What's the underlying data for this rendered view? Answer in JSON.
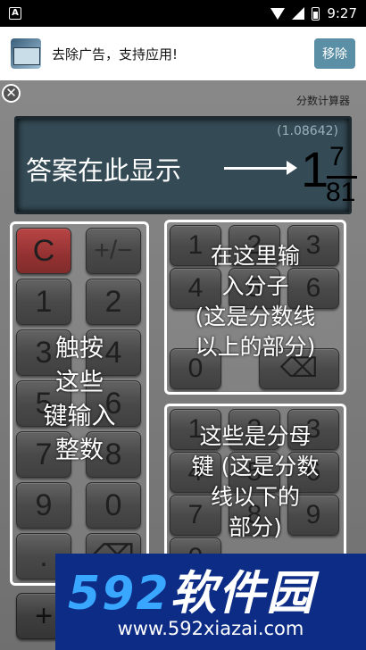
{
  "status_bar": {
    "app_icon_letter": "A",
    "time": "9:27"
  },
  "ad": {
    "text": "去除广告，支持应用!",
    "button_label": "移除"
  },
  "app": {
    "title": "分数计算器",
    "close_symbol": "⊗"
  },
  "display": {
    "decimal": "(1.08642)",
    "hint": "答案在此显示",
    "whole": "1",
    "numerator": "7",
    "denominator": "81"
  },
  "integer_keys": [
    "C",
    "+/−",
    "1",
    "2",
    "3",
    "4",
    "5",
    "6",
    "7",
    "8",
    "9",
    "0",
    ".",
    "⌫",
    "+"
  ],
  "numerator_keys": [
    "1",
    "2",
    "3",
    "4",
    "5",
    "6",
    "0",
    "⌫"
  ],
  "denominator_keys": [
    "1",
    "2",
    "3",
    "4",
    "5",
    "6",
    "7",
    "8",
    "9",
    "0"
  ],
  "tips": {
    "integer": "触按\n这些\n键输入\n整数",
    "numerator": "在这里输\n入分子\n(这是分数线\n以上的部分)",
    "denominator": "这些是分母\n键 (这是分数\n线以下的\n部分)"
  },
  "watermark": {
    "logo_digits": "592",
    "logo_text": "软件园",
    "url": "www.592xiazai.com"
  },
  "colors": {
    "ad_button": "#5b8fa6",
    "display_bg": "#344a55",
    "clear_key": "#8d2525",
    "watermark_bg": "#0d2c85"
  }
}
